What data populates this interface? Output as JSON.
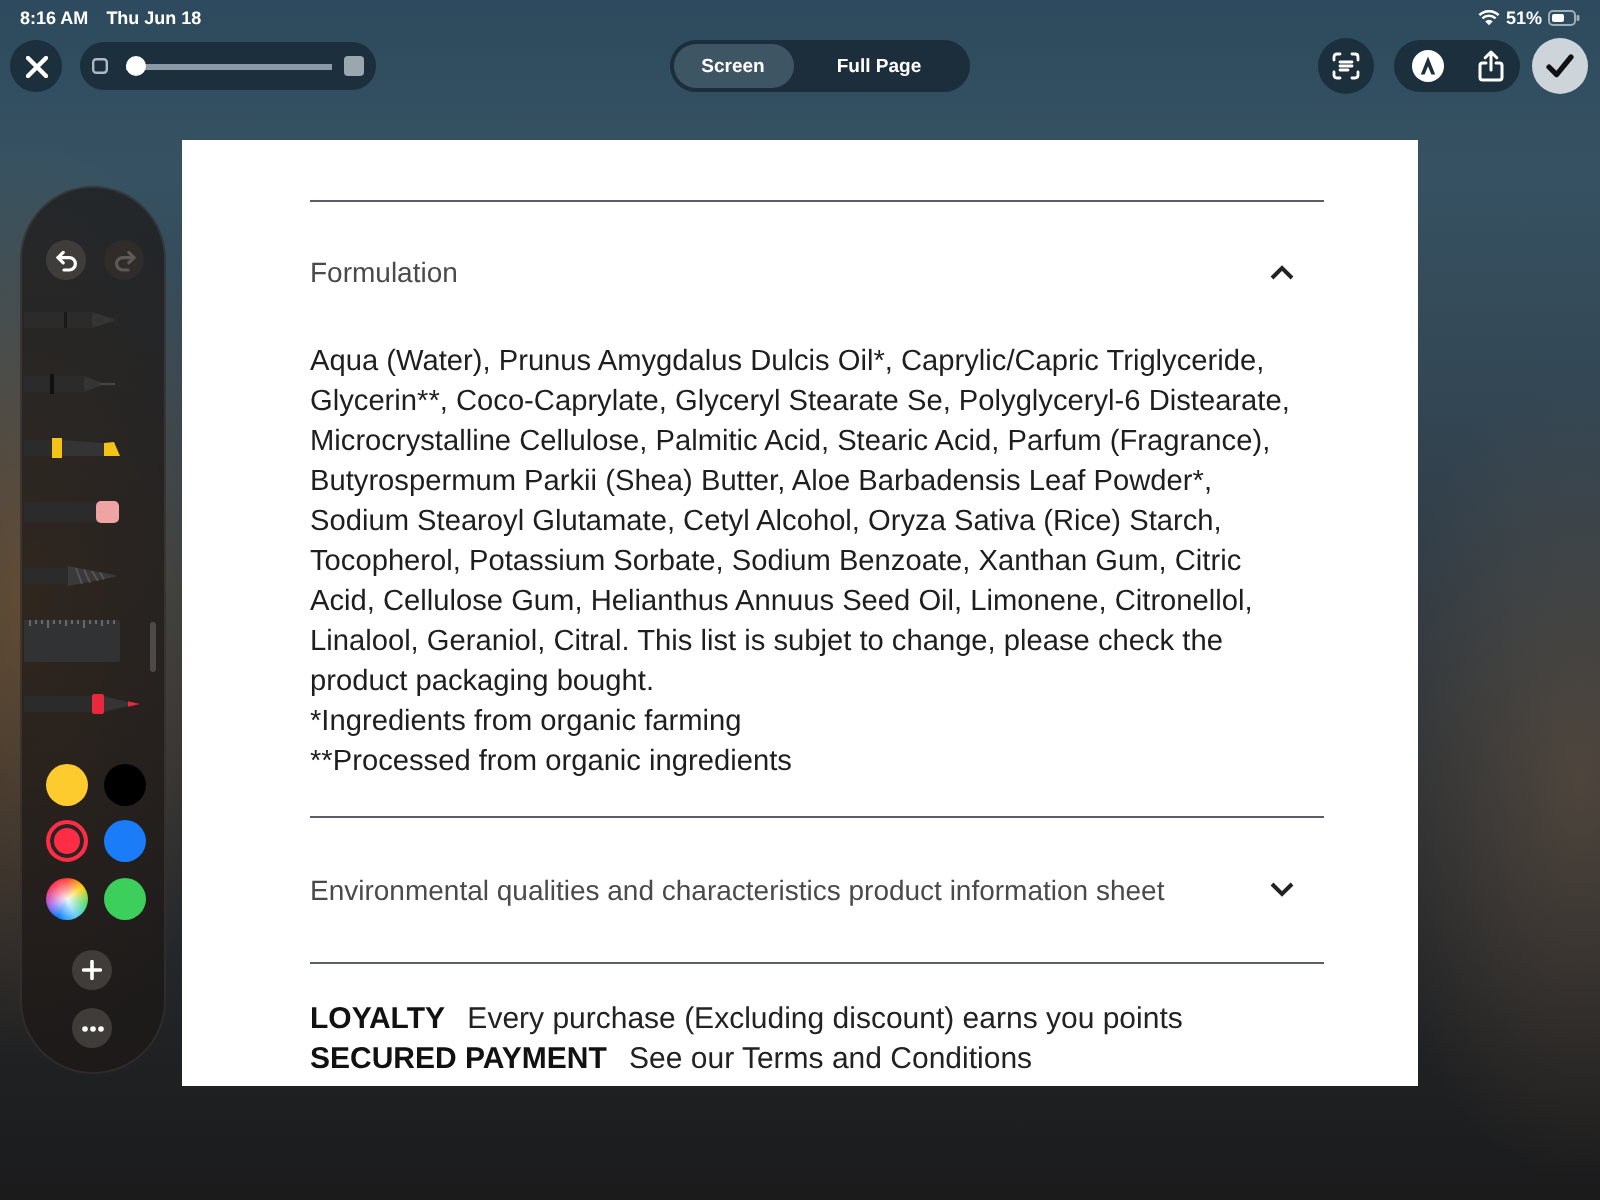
{
  "status_bar": {
    "time": "8:16 AM",
    "date": "Thu Jun 18",
    "battery": "51%"
  },
  "toolbar": {
    "zoom_slider": {
      "level": 0
    },
    "modes": [
      {
        "label": "Screen",
        "selected": true
      },
      {
        "label": "Full Page",
        "selected": false
      }
    ]
  },
  "markup_palette": {
    "undo": {
      "disabled": false
    },
    "redo": {
      "disabled": true
    },
    "tools": [
      {
        "kind": "pen",
        "selected": false
      },
      {
        "kind": "fineliner",
        "selected": false
      },
      {
        "kind": "highlighter",
        "selected": false
      },
      {
        "kind": "eraser",
        "selected": false
      },
      {
        "kind": "pencil",
        "selected": false
      },
      {
        "kind": "ruler",
        "selected": false
      },
      {
        "kind": "marker",
        "selected": true
      }
    ],
    "colors": [
      {
        "kind": "swatch",
        "color": "#fdcb2e",
        "selected": false
      },
      {
        "kind": "swatch",
        "color": "#000000",
        "selected": false
      },
      {
        "kind": "swatch",
        "color": "#fe2c45",
        "selected": true
      },
      {
        "kind": "swatch",
        "color": "#1a7cf9",
        "selected": false
      },
      {
        "kind": "picker",
        "selected": false
      },
      {
        "kind": "swatch",
        "color": "#3ccf5b",
        "selected": false
      }
    ]
  },
  "page": {
    "sections": [
      {
        "title": "Formulation",
        "expanded": true,
        "content": "Aqua (Water), Prunus Amygdalus Dulcis Oil*, Caprylic/Capric Triglyceride, Glycerin**, Coco-Caprylate, Glyceryl Stearate Se, Polyglyceryl-6 Distearate, Microcrystalline Cellulose, Palmitic Acid, Stearic Acid, Parfum (Fragrance), Butyrospermum Parkii (Shea) Butter, Aloe Barbadensis Leaf Powder*, Sodium Stearoyl Glutamate, Cetyl Alcohol, Oryza Sativa (Rice) Starch, Tocopherol, Potassium Sorbate, Sodium Benzoate, Xanthan Gum, Citric Acid, Cellulose Gum, Helianthus Annuus Seed Oil, Limonene, Citronellol, Linalool, Geraniol, Citral. This list is subjet to change, please check the product packaging bought.",
        "notes": [
          "*Ingredients from organic farming",
          "**Processed from organic ingredients"
        ]
      },
      {
        "title": "Environmental qualities and characteristics product information sheet",
        "expanded": false
      }
    ],
    "perks": [
      "**LOYALTY** Every purchase (Excluding discount) earns you points",
      "**SECURED PAYMENT** See our Terms and Conditions"
    ]
  }
}
